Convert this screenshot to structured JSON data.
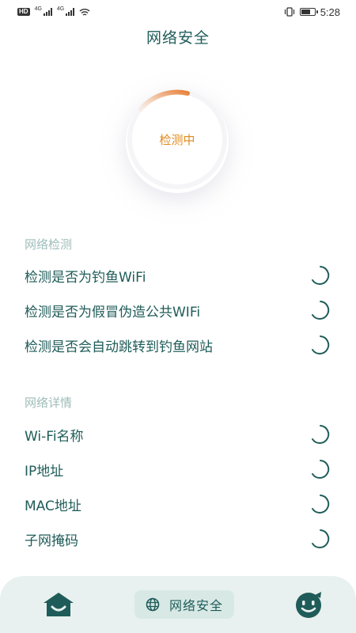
{
  "status_bar": {
    "hd": "HD",
    "net1": "4G",
    "net2": "4G",
    "time": "5:28",
    "battery_level": 0.7
  },
  "header": {
    "title": "网络安全"
  },
  "scan": {
    "status_label": "检测中",
    "progress_fraction": 0.15
  },
  "network_check": {
    "title": "网络检测",
    "items": [
      {
        "label": "检测是否为钓鱼WiFi"
      },
      {
        "label": "检测是否为假冒伪造公共WIFi"
      },
      {
        "label": "检测是否会自动跳转到钓鱼网站"
      }
    ]
  },
  "network_details": {
    "title": "网络详情",
    "items": [
      {
        "label": "Wi-Fi名称"
      },
      {
        "label": "IP地址"
      },
      {
        "label": "MAC地址"
      },
      {
        "label": "子网掩码"
      }
    ]
  },
  "bottom_nav": {
    "home_icon": "home-icon",
    "center_label": "网络安全",
    "center_icon": "globe-icon",
    "profile_icon": "smiley-face-icon"
  },
  "colors": {
    "accent": "#1f5c59",
    "section_title": "#9ebdb9",
    "scanning": "#e08a1e",
    "nav_bg": "#e8f1ef"
  }
}
